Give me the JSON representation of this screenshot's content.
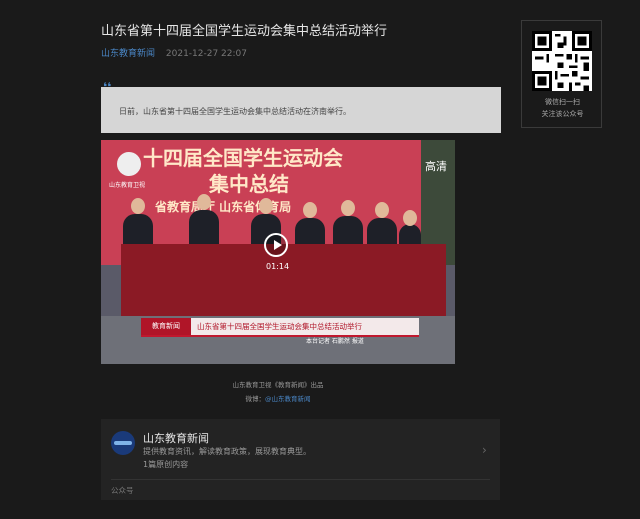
{
  "article": {
    "title": "山东省第十四届全国学生运动会集中总结活动举行",
    "account": "山东教育新闻",
    "date": "2021-12-27 22:07",
    "summary": "日前，山东省第十四届全国学生运动会集中总结活动在济南举行。"
  },
  "qr": {
    "line1": "微信扫一扫",
    "line2": "关注该公众号"
  },
  "video": {
    "banner_line1": "十四届全国学生运动会",
    "banner_line2": "集中总结",
    "banner_line3": "省教育局厅  山东省体育局",
    "logo_label": "山东教育卫视",
    "quality_label": "高清",
    "duration": "01:14",
    "caption_logo": "教育新闻",
    "caption_text": "山东省第十四届全国学生运动会集中总结活动举行",
    "caption_reporter": "本台记者 石鹏然 报道"
  },
  "credit": {
    "line1": "山东教育卫视《教育新闻》出品",
    "weibo_prefix": "微博：",
    "weibo_handle": "@山东教育新闻"
  },
  "profile": {
    "name": "山东教育新闻",
    "description": "提供教育资讯，解读教育政策，展现教育典型。",
    "original_count": "1篇原创内容",
    "footer": "公众号"
  }
}
